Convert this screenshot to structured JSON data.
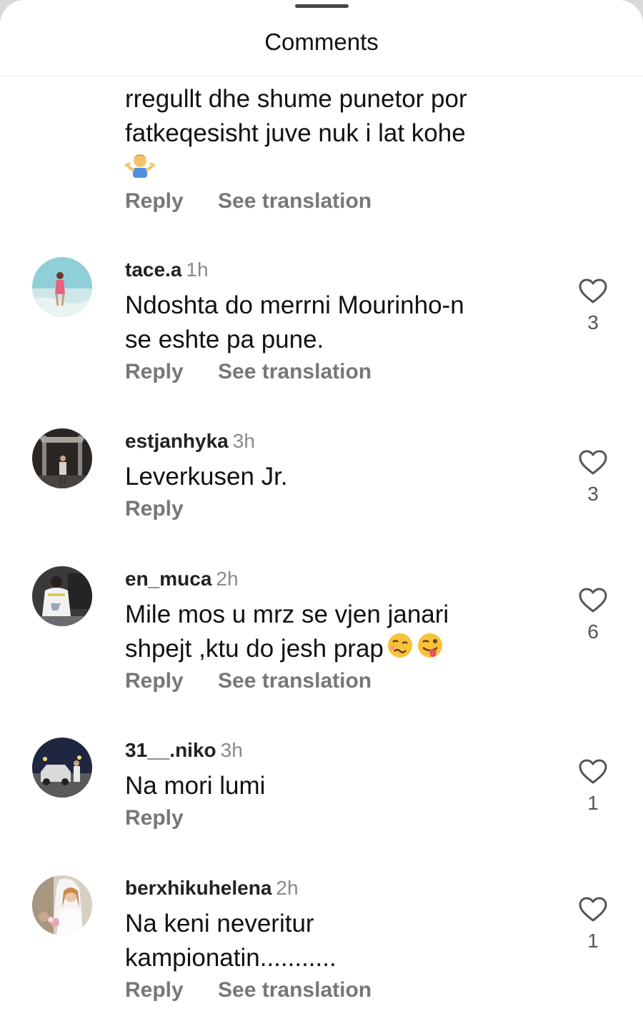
{
  "header": {
    "title": "Comments"
  },
  "partial_comment": {
    "lines": [
      "rregullt dhe shume punetor por",
      "fatkeqesisht juve nuk i lat kohe"
    ],
    "emoji": "person-shrugging-emoji",
    "reply_label": "Reply",
    "translate_label": "See translation"
  },
  "comments": [
    {
      "username": "tace.a",
      "time": "1h",
      "lines": [
        "Ndoshta do merrni Mourinho-n",
        "se eshte pa pune."
      ],
      "reply_label": "Reply",
      "translate_label": "See translation",
      "likes": "3"
    },
    {
      "username": "estjanhyka",
      "time": "3h",
      "lines": [
        "Leverkusen Jr."
      ],
      "reply_label": "Reply",
      "likes": "3"
    },
    {
      "username": "en_muca",
      "time": "2h",
      "lines": [
        "Mile mos u mrz  se vjen janari",
        "shpejt ,ktu do jesh prap"
      ],
      "emojis": [
        "woozy-face-emoji",
        "winking-tongue-face-emoji"
      ],
      "reply_label": "Reply",
      "translate_label": "See translation",
      "likes": "6"
    },
    {
      "username": "31__.niko",
      "time": "3h",
      "lines": [
        "Na mori lumi"
      ],
      "reply_label": "Reply",
      "likes": "1"
    },
    {
      "username": "berxhikuhelena",
      "time": "2h",
      "lines": [
        "Na keni neveritur",
        "kampionatin..........."
      ],
      "reply_label": "Reply",
      "translate_label": "See translation",
      "likes": "1"
    }
  ]
}
